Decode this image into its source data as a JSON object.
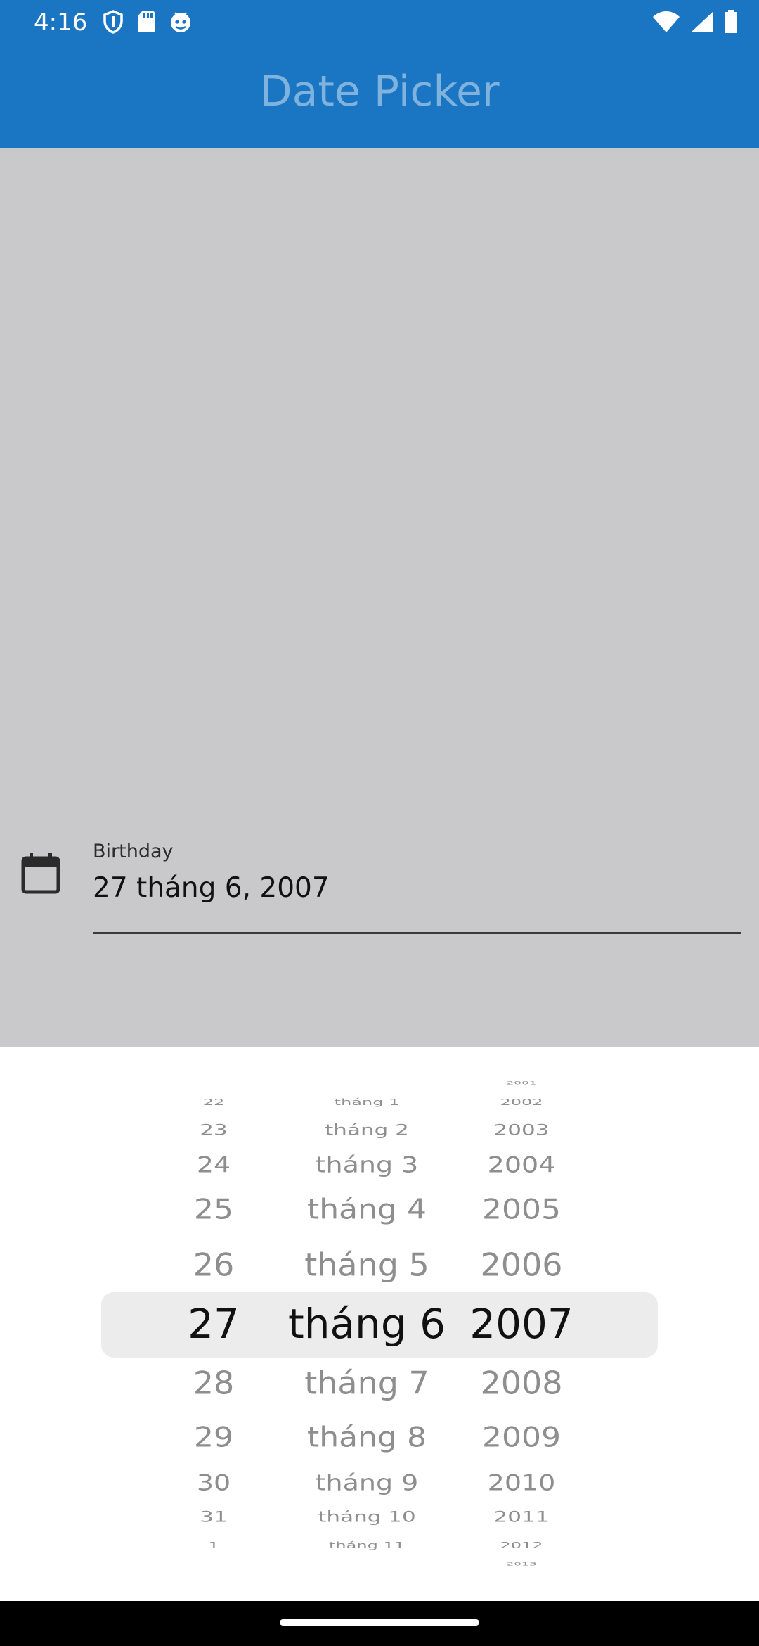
{
  "status_bar": {
    "time": "4:16",
    "left_icons": [
      "shield-icon",
      "sd-card-icon",
      "android-debug-icon"
    ],
    "right_icons": [
      "wifi-icon",
      "cellular-signal-icon",
      "battery-icon"
    ]
  },
  "app_bar": {
    "title": "Date Picker",
    "background": "#1a76c2"
  },
  "form": {
    "icon": "calendar-icon",
    "label": "Birthday",
    "value": "27 tháng 6, 2007"
  },
  "picker": {
    "day": {
      "items": [
        "22",
        "23",
        "24",
        "25",
        "26",
        "27",
        "28",
        "29",
        "30",
        "31",
        "1"
      ],
      "selected": "27"
    },
    "month": {
      "items": [
        "tháng 1",
        "tháng 2",
        "tháng 3",
        "tháng 4",
        "tháng 5",
        "tháng 6",
        "tháng 7",
        "tháng 8",
        "tháng 9",
        "tháng 10",
        "tháng 11"
      ],
      "selected": "tháng 6"
    },
    "year": {
      "items": [
        "2001",
        "2002",
        "2003",
        "2004",
        "2005",
        "2006",
        "2007",
        "2008",
        "2009",
        "2010",
        "2011",
        "2012",
        "2013"
      ],
      "selected": "2007"
    }
  }
}
